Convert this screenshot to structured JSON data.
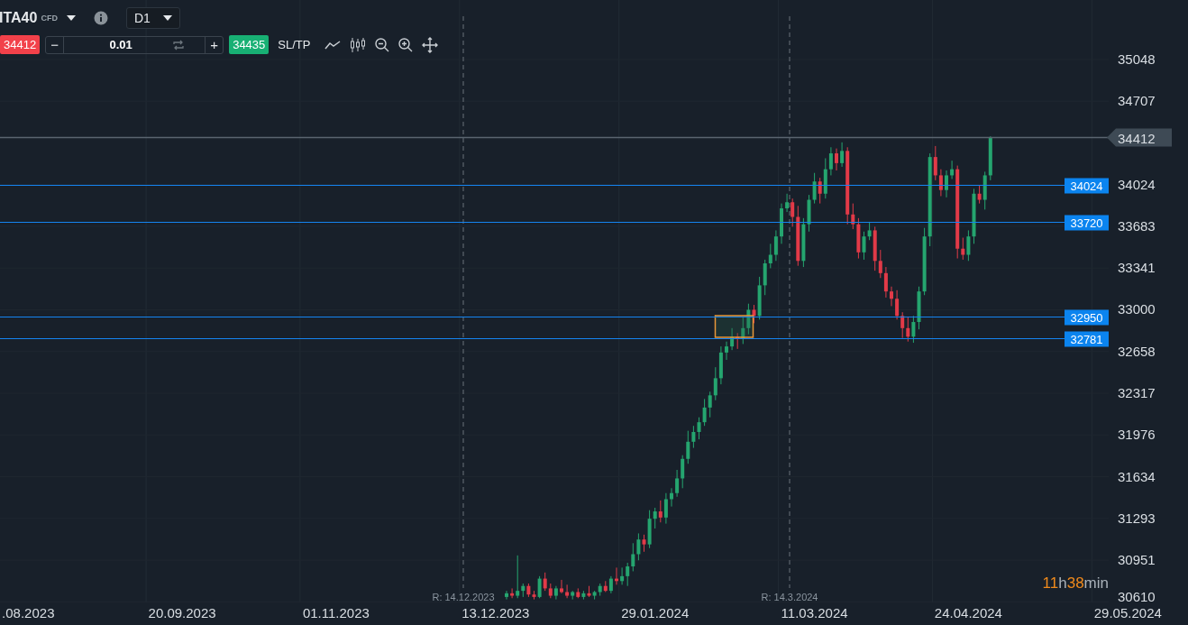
{
  "toolbar": {
    "symbol": "ITA40",
    "symbol_type": "CFD",
    "timeframe": "D1",
    "bid": "34412",
    "decrement": "−",
    "quantity": "0.01",
    "increment": "+",
    "ask": "34435",
    "sl_tp": "SL/TP"
  },
  "current_price": "34412",
  "levels": [
    {
      "label": "34024"
    },
    {
      "label": "33720"
    },
    {
      "label": "32950"
    },
    {
      "label": "32781"
    }
  ],
  "markers": [
    {
      "label": "R: 14.12.2023"
    },
    {
      "label": "R: 14.3.2024"
    }
  ],
  "countdown": [
    {
      "text": "11",
      "kind": "number"
    },
    {
      "text": "h",
      "kind": "unit"
    },
    {
      "text": "38",
      "kind": "number"
    },
    {
      "text": "min",
      "kind": "unit"
    }
  ],
  "chart_data": {
    "type": "candlestick",
    "categories": [
      null,
      null,
      null,
      null,
      null,
      ".08.2023",
      null,
      null,
      null,
      null,
      null,
      null,
      null,
      null,
      null,
      null,
      null,
      null,
      null,
      null,
      null,
      null,
      null,
      null,
      null,
      null,
      null,
      null,
      null,
      null,
      null,
      null,
      null,
      "20.09.2023",
      null,
      null,
      null,
      null,
      null,
      null,
      null,
      null,
      null,
      null,
      null,
      null,
      null,
      null,
      null,
      null,
      null,
      null,
      null,
      null,
      null,
      null,
      null,
      null,
      null,
      null,
      null,
      "01.11.2023",
      null,
      null,
      null,
      null,
      null,
      null,
      null,
      null,
      null,
      null,
      null,
      null,
      null,
      null,
      null,
      null,
      null,
      null,
      null,
      null,
      null,
      null,
      null,
      null,
      null,
      null,
      null,
      null,
      "13.12.2023",
      null,
      null,
      null,
      null,
      null,
      null,
      null,
      null,
      null,
      null,
      null,
      null,
      null,
      null,
      null,
      null,
      null,
      null,
      null,
      null,
      null,
      null,
      null,
      null,
      null,
      null,
      null,
      null,
      "29.01.2024",
      null,
      null,
      null,
      null,
      null,
      null,
      null,
      null,
      null,
      null,
      null,
      null,
      null,
      null,
      null,
      null,
      null,
      null,
      null,
      null,
      null,
      null,
      null,
      null,
      null,
      null,
      null,
      null,
      "11.03.2024",
      null,
      null,
      null,
      null,
      null,
      null,
      null,
      null,
      null,
      null,
      null,
      null,
      null,
      null,
      null,
      null,
      null,
      null,
      null,
      null,
      null,
      null,
      null,
      null,
      null,
      null,
      null,
      "24.04.2024",
      null,
      null,
      null,
      null,
      null,
      null,
      null,
      null,
      null,
      null,
      null,
      null,
      null,
      null,
      null,
      null,
      null,
      null,
      null,
      null,
      null,
      null,
      null,
      null,
      null,
      null,
      null,
      null,
      "29.05.2024",
      null,
      null,
      null,
      null,
      null,
      null,
      null
    ],
    "ohlc": [
      null,
      null,
      null,
      null,
      null,
      null,
      null,
      null,
      null,
      null,
      null,
      null,
      null,
      null,
      null,
      null,
      null,
      null,
      null,
      null,
      null,
      null,
      null,
      null,
      null,
      null,
      null,
      null,
      null,
      null,
      null,
      null,
      null,
      null,
      null,
      null,
      null,
      null,
      null,
      null,
      null,
      null,
      null,
      null,
      null,
      null,
      null,
      null,
      null,
      null,
      null,
      null,
      null,
      null,
      null,
      null,
      null,
      null,
      null,
      null,
      null,
      null,
      null,
      null,
      null,
      null,
      null,
      null,
      null,
      null,
      null,
      null,
      null,
      null,
      null,
      null,
      null,
      null,
      null,
      null,
      null,
      null,
      null,
      null,
      null,
      null,
      null,
      null,
      null,
      null,
      null,
      null,
      [
        30650,
        30700,
        30630,
        30680
      ],
      [
        30680,
        30720,
        30640,
        30660
      ],
      [
        30660,
        30990,
        30640,
        30700
      ],
      [
        30700,
        30760,
        30650,
        30740
      ],
      [
        30740,
        30760,
        30650,
        30670
      ],
      [
        30670,
        30700,
        30630,
        30650
      ],
      [
        30650,
        30820,
        30640,
        30800
      ],
      [
        30800,
        30850,
        30700,
        30720
      ],
      [
        30720,
        30760,
        30640,
        30660
      ],
      [
        30660,
        30740,
        30630,
        30720
      ],
      [
        30720,
        30790,
        30680,
        30690
      ],
      [
        30690,
        30750,
        30640,
        30660
      ],
      [
        30660,
        30700,
        30630,
        30690
      ],
      [
        30690,
        30720,
        30640,
        30650
      ],
      [
        30650,
        30700,
        30630,
        30680
      ],
      [
        30680,
        30740,
        30650,
        30660
      ],
      [
        30660,
        30700,
        30630,
        30690
      ],
      [
        30690,
        30760,
        30660,
        30740
      ],
      [
        30740,
        30780,
        30690,
        30700
      ],
      [
        30700,
        30820,
        30680,
        30800
      ],
      [
        30800,
        30890,
        30750,
        30780
      ],
      [
        30780,
        30890,
        30750,
        30820
      ],
      [
        30820,
        30930,
        30740,
        30900
      ],
      [
        30900,
        31090,
        30860,
        31000
      ],
      [
        31000,
        31170,
        30950,
        31120
      ],
      [
        31120,
        31160,
        31020,
        31080
      ],
      [
        31080,
        31360,
        31050,
        31290
      ],
      [
        31290,
        31380,
        31210,
        31350
      ],
      [
        31350,
        31440,
        31260,
        31300
      ],
      [
        31300,
        31500,
        31250,
        31450
      ],
      [
        31450,
        31540,
        31390,
        31500
      ],
      [
        31500,
        31690,
        31470,
        31620
      ],
      [
        31620,
        31810,
        31540,
        31780
      ],
      [
        31780,
        32010,
        31740,
        31920
      ],
      [
        31920,
        32050,
        31870,
        32000
      ],
      [
        32000,
        32120,
        31940,
        32080
      ],
      [
        32080,
        32270,
        32050,
        32200
      ],
      [
        32200,
        32330,
        32120,
        32300
      ],
      [
        32300,
        32530,
        32260,
        32440
      ],
      [
        32440,
        32700,
        32390,
        32650
      ],
      [
        32650,
        32740,
        32590,
        32700
      ],
      [
        32700,
        32850,
        32670,
        32780
      ],
      [
        32780,
        32810,
        32680,
        32760
      ],
      [
        32760,
        32940,
        32720,
        32850
      ],
      [
        32850,
        33050,
        32800,
        33000
      ],
      [
        33000,
        33040,
        32890,
        32950
      ],
      [
        32950,
        33270,
        32920,
        33200
      ],
      [
        33200,
        33410,
        33120,
        33380
      ],
      [
        33380,
        33540,
        33340,
        33450
      ],
      [
        33450,
        33650,
        33400,
        33600
      ],
      [
        33600,
        33870,
        33540,
        33830
      ],
      [
        33830,
        33950,
        33800,
        33880
      ],
      [
        33880,
        33910,
        33680,
        33760
      ],
      [
        33760,
        33850,
        33360,
        33400
      ],
      [
        33400,
        33750,
        33350,
        33700
      ],
      [
        33700,
        33940,
        33640,
        33900
      ],
      [
        33900,
        34120,
        33870,
        34050
      ],
      [
        34050,
        34080,
        33870,
        33950
      ],
      [
        33950,
        34240,
        33910,
        34150
      ],
      [
        34150,
        34330,
        34100,
        34280
      ],
      [
        34280,
        34320,
        34140,
        34200
      ],
      [
        34200,
        34370,
        34170,
        34300
      ],
      [
        34300,
        34330,
        33700,
        33780
      ],
      [
        33780,
        33870,
        33660,
        33700
      ],
      [
        33700,
        33750,
        33420,
        33470
      ],
      [
        33470,
        33640,
        33410,
        33600
      ],
      [
        33600,
        33720,
        33570,
        33650
      ],
      [
        33650,
        33680,
        33320,
        33400
      ],
      [
        33400,
        33490,
        33260,
        33300
      ],
      [
        33300,
        33350,
        33100,
        33150
      ],
      [
        33150,
        33190,
        33030,
        33090
      ],
      [
        33090,
        33160,
        32920,
        32950
      ],
      [
        32950,
        32980,
        32770,
        32850
      ],
      [
        32850,
        32940,
        32740,
        32780
      ],
      [
        32780,
        32950,
        32730,
        32900
      ],
      [
        32900,
        33190,
        32840,
        33150
      ],
      [
        33150,
        33670,
        33120,
        33600
      ],
      [
        33600,
        34280,
        33520,
        34250
      ],
      [
        34250,
        34340,
        34060,
        34100
      ],
      [
        34100,
        34150,
        33930,
        33980
      ],
      [
        33980,
        34140,
        33920,
        34100
      ],
      [
        34100,
        34220,
        34070,
        34150
      ],
      [
        34150,
        34180,
        33420,
        33500
      ],
      [
        33500,
        33590,
        33410,
        33450
      ],
      [
        33450,
        33650,
        33400,
        33600
      ],
      [
        33600,
        33990,
        33540,
        33950
      ],
      [
        33950,
        34020,
        33870,
        33900
      ],
      [
        33900,
        34130,
        33820,
        34100
      ],
      [
        34100,
        34420,
        34060,
        34412
      ],
      null,
      null,
      null,
      null,
      null,
      null,
      null,
      null,
      null,
      null,
      null,
      null,
      null,
      null,
      null,
      null,
      null,
      null,
      null,
      null,
      null,
      null,
      null,
      null,
      null,
      null,
      null,
      null,
      null,
      null,
      null,
      null
    ],
    "yticks": [
      35048,
      34707,
      34024,
      33683,
      33341,
      33000,
      32658,
      32317,
      31976,
      31634,
      31293,
      30951,
      30610
    ],
    "ylim": [
      30605,
      35535
    ]
  }
}
